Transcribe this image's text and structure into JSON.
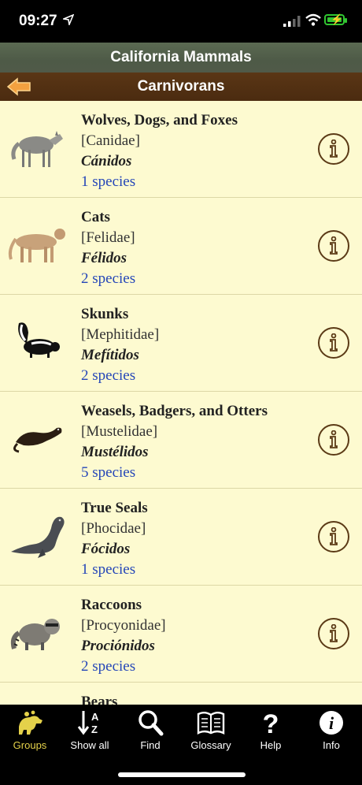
{
  "status_bar": {
    "time": "09:27",
    "location_icon": "location-arrow-icon"
  },
  "nav": {
    "app_title": "California Mammals",
    "section_title": "Carnivorans",
    "back_icon": "back-arrow-icon"
  },
  "groups": [
    {
      "name": "Wolves, Dogs, and Foxes",
      "family": "[Canidae]",
      "spanish": "Cánidos",
      "count": "1 species",
      "icon": "wolf-image"
    },
    {
      "name": "Cats",
      "family": "[Felidae]",
      "spanish": "Félidos",
      "count": "2 species",
      "icon": "cougar-image"
    },
    {
      "name": "Skunks",
      "family": "[Mephitidae]",
      "spanish": "Mefítidos",
      "count": "2 species",
      "icon": "skunk-image"
    },
    {
      "name": "Weasels, Badgers, and Otters",
      "family": "[Mustelidae]",
      "spanish": "Mustélidos",
      "count": "5 species",
      "icon": "weasel-image"
    },
    {
      "name": "True Seals",
      "family": "[Phocidae]",
      "spanish": "Fócidos",
      "count": "1 species",
      "icon": "seal-image"
    },
    {
      "name": "Raccoons",
      "family": "[Procyonidae]",
      "spanish": "Prociónidos",
      "count": "2 species",
      "icon": "raccoon-image"
    },
    {
      "name": "Bears",
      "family": "",
      "spanish": "",
      "count": "",
      "icon": "bear-image"
    }
  ],
  "tabs": [
    {
      "label": "Groups",
      "icon": "groups-icon",
      "active": true
    },
    {
      "label": "Show all",
      "icon": "sort-az-icon",
      "active": false
    },
    {
      "label": "Find",
      "icon": "search-icon",
      "active": false
    },
    {
      "label": "Glossary",
      "icon": "book-icon",
      "active": false
    },
    {
      "label": "Help",
      "icon": "help-icon",
      "active": false
    },
    {
      "label": "Info",
      "icon": "info-icon",
      "active": false
    }
  ],
  "colors": {
    "list_bg": "#fdfad0",
    "brown": "#4b2b10",
    "count_blue": "#2546b8",
    "active_tab": "#e4d14a"
  }
}
